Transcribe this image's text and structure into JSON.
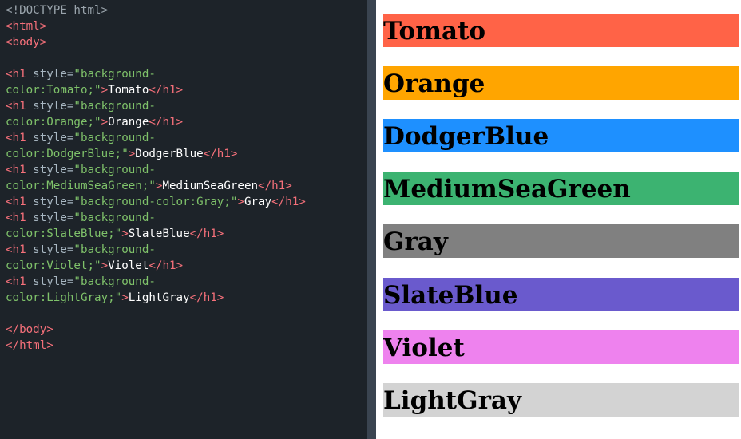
{
  "code": {
    "doctype": "<!DOCTYPE html>",
    "html_open": "<html>",
    "body_open": "<body>",
    "body_close": "</body>",
    "html_close": "</html>",
    "h1_open": "<h1",
    "h1_close": "</h1>",
    "style_attr": " style=",
    "close_gt": ">",
    "lines": [
      {
        "style": "\"background-",
        "style2": "color:Tomato;\"",
        "text": "Tomato"
      },
      {
        "style": "\"background-",
        "style2": "color:Orange;\"",
        "text": "Orange"
      },
      {
        "style": "\"background-",
        "style2": "color:DodgerBlue;\"",
        "text": "DodgerBlue"
      },
      {
        "style": "\"background-",
        "style2": "color:MediumSeaGreen;\"",
        "text": "MediumSeaGreen"
      },
      {
        "style": "\"background-color:Gray;\"",
        "text": "Gray"
      },
      {
        "style": "\"background-",
        "style2": "color:SlateBlue;\"",
        "text": "SlateBlue"
      },
      {
        "style": "\"background-",
        "style2": "color:Violet;\"",
        "text": "Violet"
      },
      {
        "style": "\"background-",
        "style2": "color:LightGray;\"",
        "text": "LightGray"
      }
    ]
  },
  "result": {
    "headings": [
      {
        "label": "Tomato",
        "color": "#ff6347"
      },
      {
        "label": "Orange",
        "color": "#ffa500"
      },
      {
        "label": "DodgerBlue",
        "color": "#1e90ff"
      },
      {
        "label": "MediumSeaGreen",
        "color": "#3cb371"
      },
      {
        "label": "Gray",
        "color": "#808080"
      },
      {
        "label": "SlateBlue",
        "color": "#6a5acd"
      },
      {
        "label": "Violet",
        "color": "#ee82ee"
      },
      {
        "label": "LightGray",
        "color": "#d3d3d3"
      }
    ]
  }
}
